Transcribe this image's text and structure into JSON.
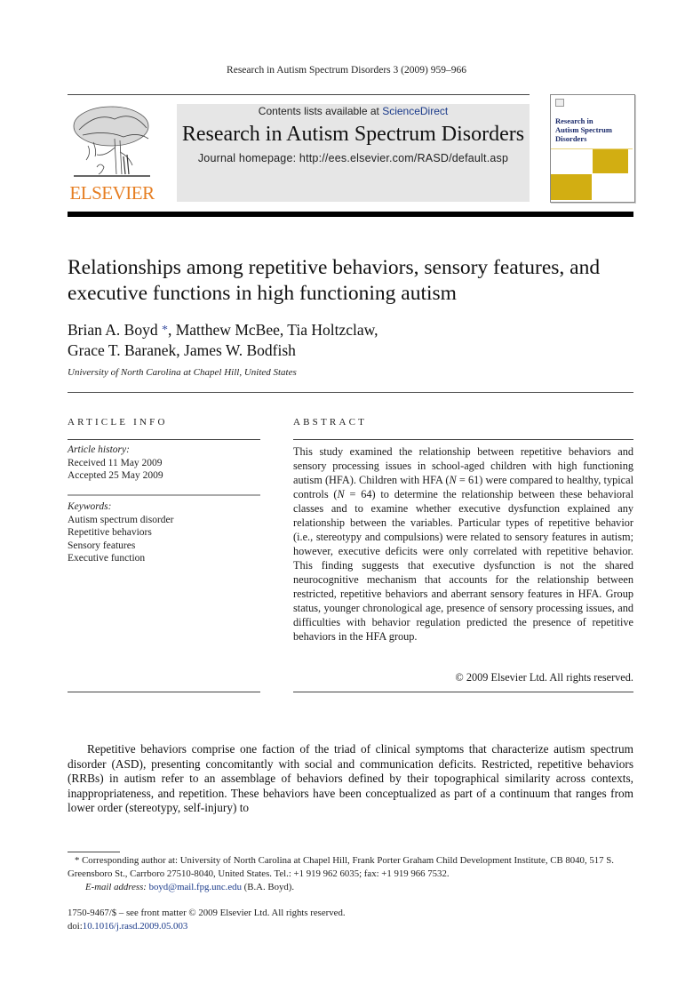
{
  "running_head": "Research in Autism Spectrum Disorders 3 (2009) 959–966",
  "publisher": {
    "logo_text": "ELSEVIER",
    "logo_icon": "elsevier-tree-icon"
  },
  "banner": {
    "contents_prefix": "Contents lists available at ",
    "contents_link": "ScienceDirect",
    "journal_title": "Research in Autism Spectrum Disorders",
    "homepage": "Journal homepage: http://ees.elsevier.com/RASD/default.asp"
  },
  "cover": {
    "title_lines": [
      "Research in",
      "Autism Spectrum",
      "Disorders"
    ],
    "accent_color": "#d2ae12"
  },
  "article": {
    "title": "Relationships among repetitive behaviors, sensory features, and executive functions in high functioning autism",
    "authors_line1_pre": "Brian A. Boyd",
    "author_mark": "*",
    "authors_line1_post": ", Matthew McBee, Tia Holtzclaw,",
    "authors_line2": "Grace T. Baranek, James W. Bodfish",
    "affiliation": "University of North Carolina at Chapel Hill, United States"
  },
  "article_info": {
    "heading": "ARTICLE INFO",
    "history_label": "Article history:",
    "received": "Received 11 May 2009",
    "accepted": "Accepted 25 May 2009",
    "keywords_label": "Keywords:",
    "keywords": [
      "Autism spectrum disorder",
      "Repetitive behaviors",
      "Sensory features",
      "Executive function"
    ]
  },
  "abstract": {
    "heading": "ABSTRACT",
    "p1": "This study examined the relationship between repetitive behaviors and sensory processing issues in school-aged children with high functioning autism (HFA). Children with HFA (",
    "n_label": "N",
    "p2": " = 61) were compared to healthy, typical controls (",
    "p3": " = 64) to determine the relationship between these behavioral classes and to examine whether executive dysfunction explained any relationship between the variables. Particular types of repetitive behavior (i.e., stereotypy and compulsions) were related to sensory features in autism; however, executive deficits were only correlated with repetitive behavior. This finding suggests that executive dysfunction is not the shared neurocognitive mechanism that accounts for the relationship between restricted, repetitive behaviors and aberrant sensory features in HFA. Group status, younger chronological age, presence of sensory processing issues, and difficulties with behavior regulation predicted the presence of repetitive behaviors in the HFA group.",
    "copyright": "© 2009 Elsevier Ltd. All rights reserved."
  },
  "body": {
    "paragraph": "Repetitive behaviors comprise one faction of the triad of clinical symptoms that characterize autism spectrum disorder (ASD), presenting concomitantly with social and communication deficits. Restricted, repetitive behaviors (RRBs) in autism refer to an assemblage of behaviors defined by their topographical similarity across contexts, inappropriateness, and repetition. These behaviors have been conceptualized as part of a continuum that ranges from lower order (stereotypy, self-injury) to"
  },
  "footnote": {
    "mark": "*",
    "text": " Corresponding author at: University of North Carolina at Chapel Hill, Frank Porter Graham Child Development Institute, CB 8040, 517 S. Greensboro St., Carrboro 27510-8040, United States. Tel.: +1 919 962 6035; fax: +1 919 966 7532.",
    "email_label": "E-mail address:",
    "email": "boyd@mail.fpg.unc.edu",
    "email_suffix": " (B.A. Boyd)."
  },
  "front_matter": {
    "issn_line": "1750-9467/$ – see front matter © 2009 Elsevier Ltd. All rights reserved.",
    "doi_prefix": "doi:",
    "doi": "10.1016/j.rasd.2009.05.003"
  }
}
